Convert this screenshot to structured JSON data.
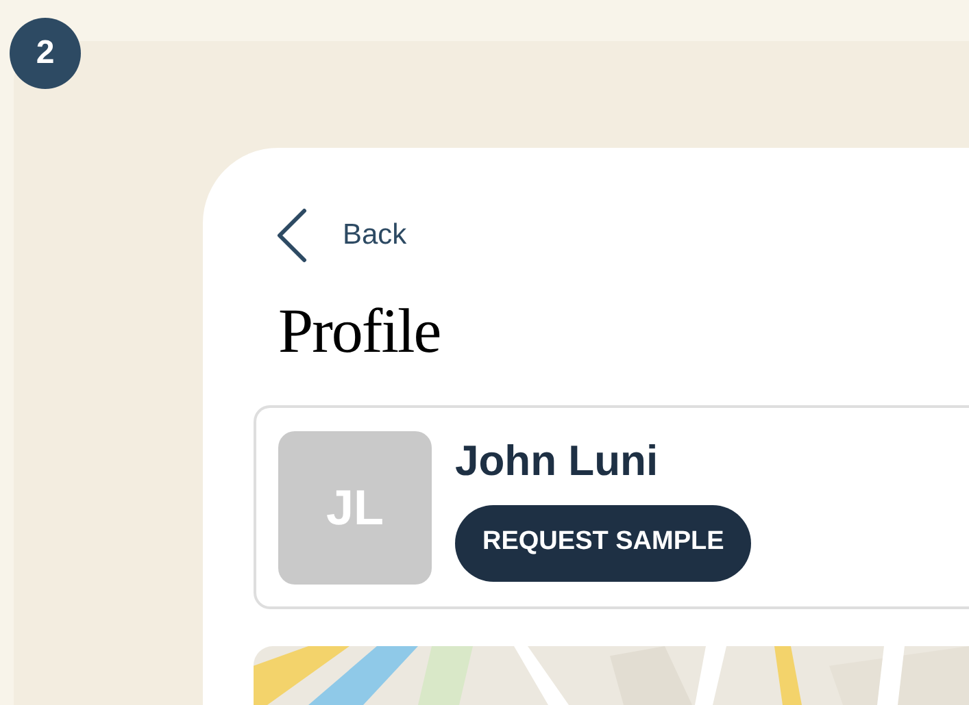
{
  "step_badge": "2",
  "back": {
    "label": "Back"
  },
  "title": "Profile",
  "profile": {
    "initials": "JL",
    "name": "John Luni",
    "action": "REQUEST SAMPLE"
  }
}
